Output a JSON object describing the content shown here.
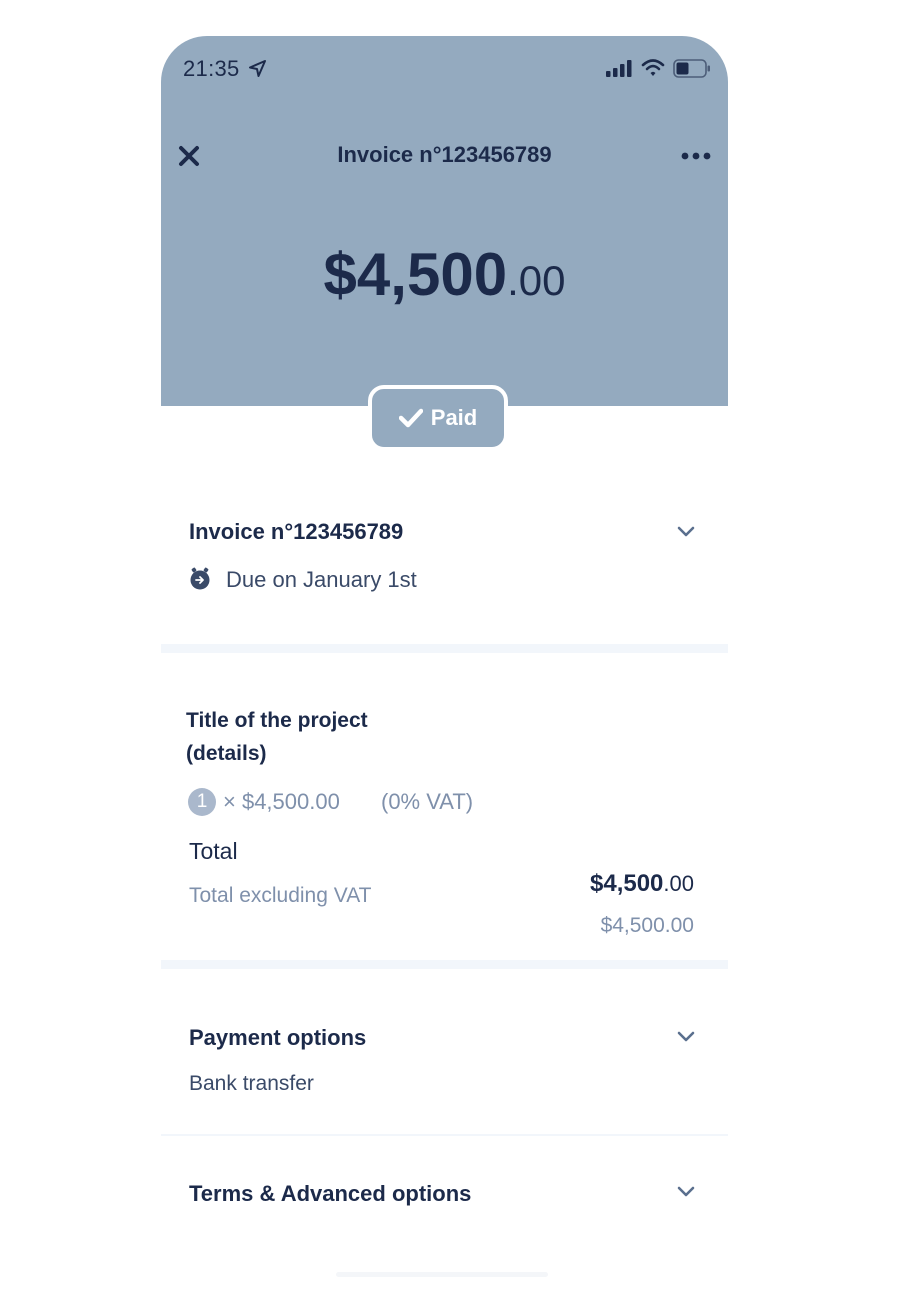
{
  "status_bar": {
    "time": "21:35"
  },
  "header": {
    "title": "Invoice n°123456789"
  },
  "amount": {
    "main": "$4,500",
    "cents": ".00"
  },
  "badge": {
    "label": "Paid"
  },
  "invoice_section": {
    "title": "Invoice n°123456789",
    "due": "Due on January 1st"
  },
  "line_item": {
    "title": "Title of the project (details)",
    "quantity": "1",
    "detail": "× $4,500.00",
    "vat": "(0% VAT)"
  },
  "totals": {
    "total_label": "Total",
    "total_main": "$4,500",
    "total_cents": ".00",
    "total_ex_vat_label": "Total excluding VAT",
    "total_ex_vat_value": "$4,500.00"
  },
  "payment": {
    "title": "Payment options",
    "value": "Bank transfer"
  },
  "terms": {
    "title": "Terms & Advanced options"
  },
  "colors": {
    "header_bg": "#94aabf",
    "text_dark": "#1c2a4a",
    "text_muted": "#7f90ab"
  },
  "icons": [
    "location-arrow-icon",
    "signal-icon",
    "wifi-icon",
    "battery-icon",
    "close-icon",
    "more-icon",
    "check-icon",
    "due-clock-icon",
    "chevron-down-icon"
  ]
}
